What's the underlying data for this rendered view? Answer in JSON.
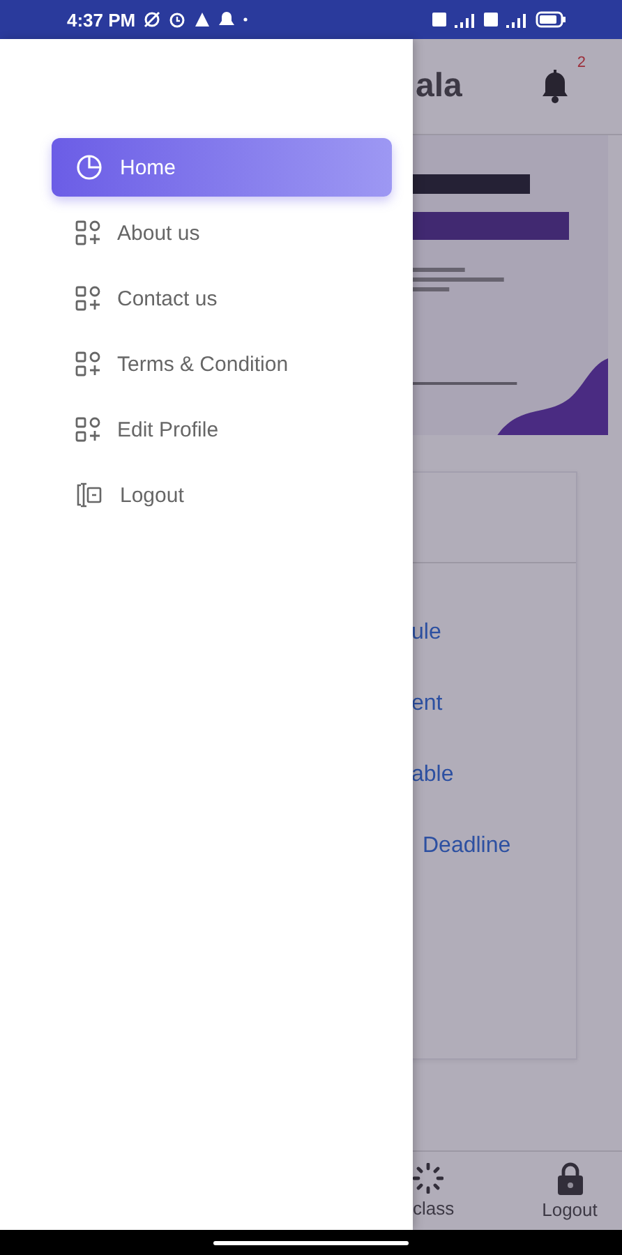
{
  "status_bar": {
    "time": "4:37 PM"
  },
  "drawer": {
    "items": [
      {
        "label": "Home",
        "selected": true,
        "kind": "home"
      },
      {
        "label": "About us",
        "selected": false,
        "kind": "page"
      },
      {
        "label": "Contact us",
        "selected": false,
        "kind": "page"
      },
      {
        "label": "Terms & Condition",
        "selected": false,
        "kind": "page"
      },
      {
        "label": "Edit Profile",
        "selected": false,
        "kind": "page"
      },
      {
        "label": "Logout",
        "selected": false,
        "kind": "logout"
      }
    ]
  },
  "behind": {
    "title": "ala",
    "notification_count": "2",
    "links": [
      "ule",
      "ent",
      "able",
      "Deadline"
    ],
    "bottom_nav": [
      {
        "label": "class",
        "kind": "class"
      },
      {
        "label": "Logout",
        "kind": "logout"
      }
    ]
  }
}
